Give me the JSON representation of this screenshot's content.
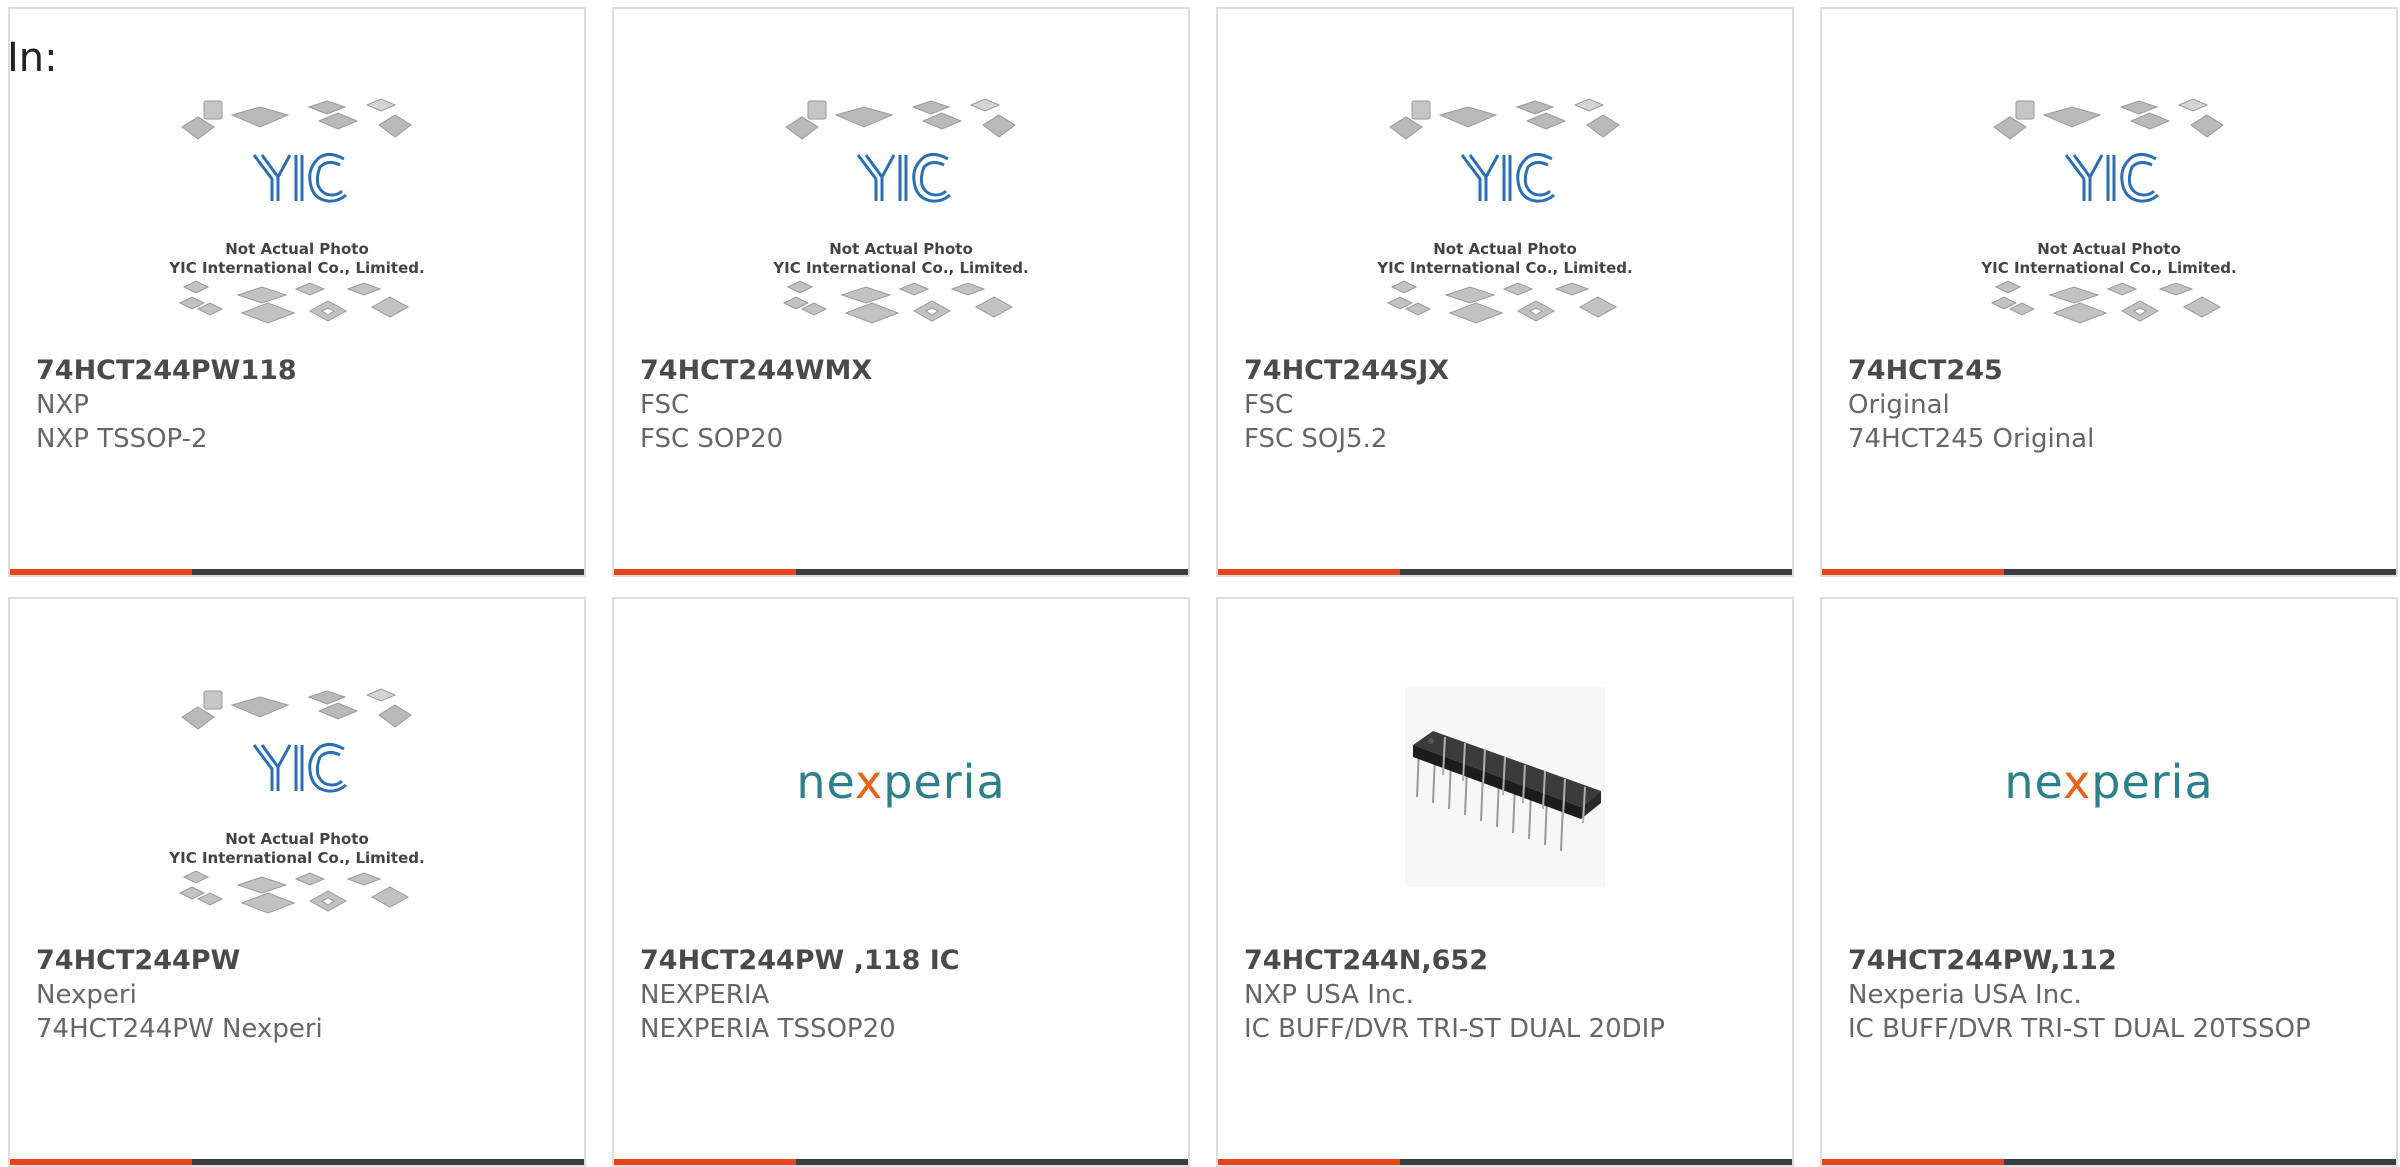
{
  "in_label": "In:",
  "placeholder": {
    "brand": "YIC",
    "line1": "Not Actual Photo",
    "line2": "YIC International Co., Limited."
  },
  "nexperia_logo": {
    "before": "ne",
    "x": "x",
    "after": "peria"
  },
  "products": [
    {
      "part": "74HCT244PW118",
      "manufacturer": "NXP",
      "description": "NXP TSSOP-2",
      "image": "placeholder"
    },
    {
      "part": "74HCT244WMX",
      "manufacturer": "FSC",
      "description": "FSC SOP20",
      "image": "placeholder"
    },
    {
      "part": "74HCT244SJX",
      "manufacturer": "FSC",
      "description": "FSC SOJ5.2",
      "image": "placeholder"
    },
    {
      "part": "74HCT245",
      "manufacturer": "Original",
      "description": "74HCT245 Original",
      "image": "placeholder"
    },
    {
      "part": "74HCT244PW",
      "manufacturer": "Nexperi",
      "description": "74HCT244PW Nexperi",
      "image": "placeholder"
    },
    {
      "part": "74HCT244PW ,118 IC",
      "manufacturer": "NEXPERIA",
      "description": "NEXPERIA TSSOP20",
      "image": "nexperia-logo"
    },
    {
      "part": "74HCT244N,652",
      "manufacturer": "NXP USA Inc.",
      "description": "IC BUFF/DVR TRI-ST DUAL 20DIP",
      "image": "dip-chip-photo"
    },
    {
      "part": "74HCT244PW,112",
      "manufacturer": "Nexperia USA Inc.",
      "description": "IC BUFF/DVR TRI-ST DUAL 20TSSOP",
      "image": "nexperia-logo"
    }
  ],
  "colors": {
    "accent_bar": "#e8441c",
    "dark_bar": "#3a3d40",
    "nexperia_teal": "#2e7f8c",
    "nexperia_orange": "#e8621c"
  }
}
